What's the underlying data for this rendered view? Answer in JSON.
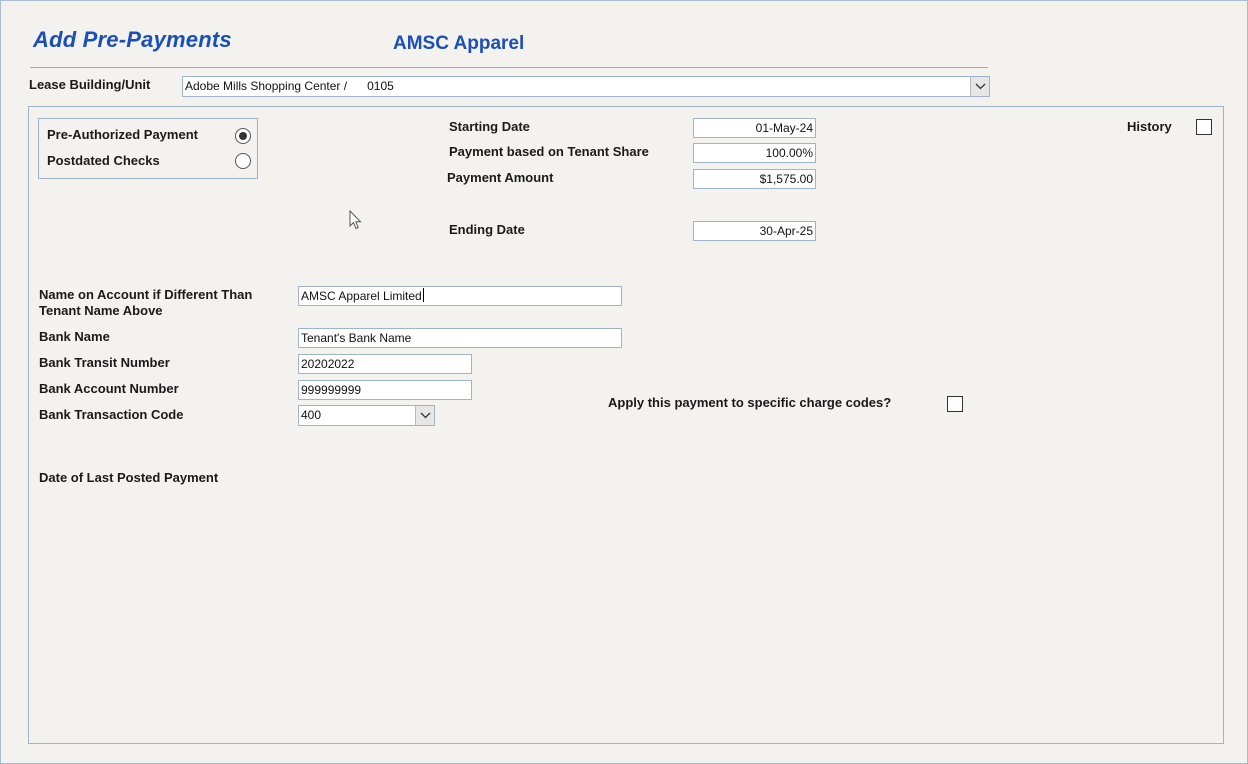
{
  "header": {
    "form_title": "Add Pre-Payments",
    "tenant_name": "AMSC Apparel"
  },
  "lease": {
    "label": "Lease Building/Unit",
    "value": "Adobe Mills Shopping Center /      0105"
  },
  "payment_type": {
    "options": [
      {
        "label": "Pre-Authorized Payment",
        "selected": true
      },
      {
        "label": "Postdated Checks",
        "selected": false
      }
    ]
  },
  "schedule": {
    "starting_date_label": "Starting Date",
    "starting_date": "01-May-24",
    "tenant_share_label": "Payment based on Tenant Share",
    "tenant_share": "100.00%",
    "amount_label": "Payment Amount",
    "amount": "$1,575.00",
    "ending_date_label": "Ending Date",
    "ending_date": "30-Apr-25"
  },
  "history": {
    "label": "History",
    "checked": false
  },
  "bank": {
    "account_name_label": "Name on Account if Different Than Tenant Name Above",
    "account_name": "AMSC Apparel Limited",
    "bank_name_label": "Bank Name",
    "bank_name": "Tenant's Bank Name",
    "transit_label": "Bank Transit Number",
    "transit": "20202022",
    "account_number_label": "Bank Account Number",
    "account_number": "999999999",
    "transaction_code_label": "Bank Transaction Code",
    "transaction_code": "400"
  },
  "charge_codes": {
    "label": "Apply this payment to specific charge codes?",
    "checked": false
  },
  "last_payment": {
    "label": "Date of Last Posted Payment"
  },
  "colors": {
    "title": "#1a4fb5",
    "background": "#f3f2ee",
    "border": "#9fb3cc"
  },
  "icons": {
    "dropdown": "chevron-down-icon",
    "pointer": "mouse-pointer-icon"
  }
}
